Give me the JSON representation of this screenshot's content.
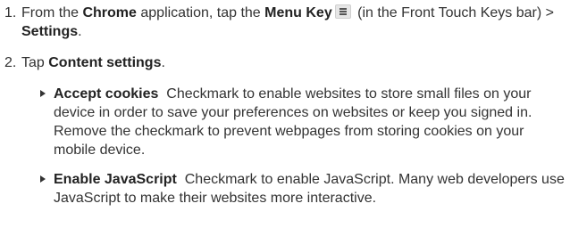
{
  "steps": [
    {
      "number": "1.",
      "t1": "From the ",
      "chrome": "Chrome",
      "t2": " application, tap the ",
      "menu_key": "Menu Key",
      "t3": " (in the Front Touch Keys bar) > ",
      "settings": "Settings",
      "t4": "."
    },
    {
      "number": "2.",
      "t1": "Tap ",
      "content_settings": "Content settings",
      "t2": "."
    }
  ],
  "icons": {
    "menu_key": "menu-key-icon"
  },
  "bullets": [
    {
      "title": "Accept cookies",
      "body": "  Checkmark to enable websites to store small files on your device in order to save your preferences on websites or keep you signed in. Remove the checkmark to prevent webpages from storing cookies on your mobile device."
    },
    {
      "title": "Enable JavaScript",
      "body": "  Checkmark to enable JavaScript. Many web developers use JavaScript to make their websites more interactive."
    }
  ]
}
